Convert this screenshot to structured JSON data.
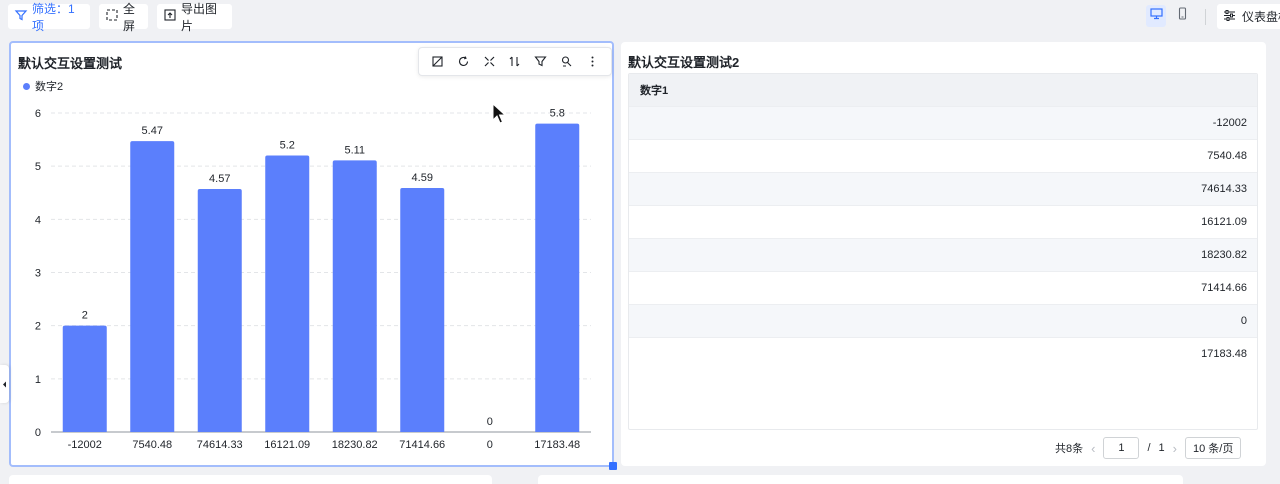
{
  "toolbar": {
    "filter_label": "筛选：1项",
    "fullscreen_label": "全屏",
    "export_label": "导出图片",
    "dashboard_label": "仪表盘样式"
  },
  "colors": {
    "accent": "#3370ff",
    "bar": "#5b7ffc"
  },
  "chart_card": {
    "title": "默认交互设置测试",
    "legend": "数字2"
  },
  "chart_data": {
    "type": "bar",
    "categories": [
      "-12002",
      "7540.48",
      "74614.33",
      "16121.09",
      "18230.82",
      "71414.66",
      "0",
      "17183.48"
    ],
    "series": [
      {
        "name": "数字2",
        "values": [
          2,
          5.47,
          4.57,
          5.2,
          5.11,
          4.59,
          0,
          5.8
        ]
      }
    ],
    "value_labels": [
      "2",
      "5.47",
      "4.57",
      "5.2",
      "5.11",
      "4.59",
      "0",
      "5.8"
    ],
    "yticks": [
      "0",
      "1",
      "2",
      "3",
      "4",
      "5",
      "6"
    ],
    "ylim": [
      0,
      6
    ],
    "grid": true,
    "legend_position": "top-left"
  },
  "table_card": {
    "title": "默认交互设置测试2",
    "column": "数字1",
    "rows": [
      "-12002",
      "7540.48",
      "74614.33",
      "16121.09",
      "18230.82",
      "71414.66",
      "0",
      "17183.48"
    ],
    "pager": {
      "total": "共8条",
      "current": "1",
      "sep": "/",
      "pages": "1",
      "size": "10 条/页"
    }
  }
}
